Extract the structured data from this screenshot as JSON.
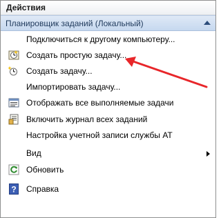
{
  "panel": {
    "title": "Действия"
  },
  "group": {
    "label": "Планировщик заданий (Локальный)"
  },
  "actions": [
    {
      "label": "Подключиться к другому компьютеру...",
      "icon": "none"
    },
    {
      "label": "Создать простую задачу...",
      "icon": "create-basic-task-icon"
    },
    {
      "label": "Создать задачу...",
      "icon": "create-task-icon"
    },
    {
      "label": "Импортировать задачу...",
      "icon": "none"
    },
    {
      "label": "Отображать все выполняемые задачи",
      "icon": "running-tasks-icon"
    },
    {
      "label": "Включить журнал всех заданий",
      "icon": "history-log-icon"
    },
    {
      "label": "Настройка учетной записи службы AT",
      "icon": "none"
    },
    {
      "label": "Вид",
      "icon": "none",
      "submenu": true
    },
    {
      "label": "Обновить",
      "icon": "refresh-icon"
    },
    {
      "label": "Справка",
      "icon": "help-icon"
    }
  ],
  "colors": {
    "annotation_arrow": "#e8262a",
    "group_header": "#c6d8ef"
  }
}
